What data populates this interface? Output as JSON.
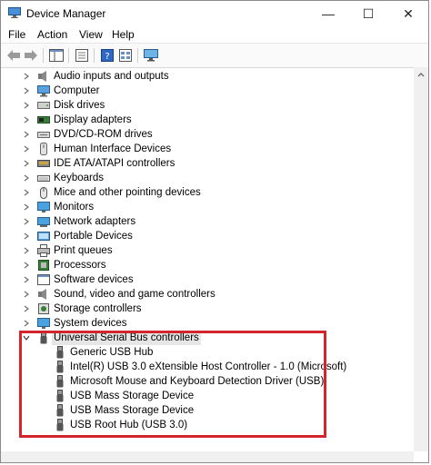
{
  "window": {
    "title": "Device Manager",
    "minimize_glyph": "—",
    "maximize_glyph": "☐",
    "close_glyph": "✕"
  },
  "menu": [
    "File",
    "Action",
    "View",
    "Help"
  ],
  "toolbar": [
    "back-arrow-icon",
    "forward-arrow-icon",
    "show-hide-console-tree-icon",
    "properties-icon",
    "help-icon",
    "view-icon",
    "scan-hardware-icon"
  ],
  "tree": {
    "categories": [
      {
        "label": "Audio inputs and outputs",
        "icon": "speaker-icon"
      },
      {
        "label": "Computer",
        "icon": "computer-icon"
      },
      {
        "label": "Disk drives",
        "icon": "disk-drive-icon"
      },
      {
        "label": "Display adapters",
        "icon": "display-adapter-icon"
      },
      {
        "label": "DVD/CD-ROM drives",
        "icon": "dvd-drive-icon"
      },
      {
        "label": "Human Interface Devices",
        "icon": "hid-icon"
      },
      {
        "label": "IDE ATA/ATAPI controllers",
        "icon": "ide-controller-icon"
      },
      {
        "label": "Keyboards",
        "icon": "keyboard-icon"
      },
      {
        "label": "Mice and other pointing devices",
        "icon": "mouse-icon"
      },
      {
        "label": "Monitors",
        "icon": "monitor-icon"
      },
      {
        "label": "Network adapters",
        "icon": "network-adapter-icon"
      },
      {
        "label": "Portable Devices",
        "icon": "portable-device-icon"
      },
      {
        "label": "Print queues",
        "icon": "printer-icon"
      },
      {
        "label": "Processors",
        "icon": "processor-icon"
      },
      {
        "label": "Software devices",
        "icon": "software-device-icon"
      },
      {
        "label": "Sound, video and game controllers",
        "icon": "sound-controller-icon"
      },
      {
        "label": "Storage controllers",
        "icon": "storage-controller-icon"
      },
      {
        "label": "System devices",
        "icon": "system-device-icon"
      }
    ],
    "usb": {
      "label": "Universal Serial Bus controllers",
      "icon": "usb-icon",
      "children": [
        "Generic USB Hub",
        "Intel(R) USB 3.0 eXtensible Host Controller - 1.0 (Microsoft)",
        "Microsoft Mouse and Keyboard Detection Driver (USB)",
        "USB Mass Storage Device",
        "USB Mass Storage Device",
        "USB Root Hub (USB 3.0)"
      ]
    }
  },
  "colors": {
    "highlight_box": "#d4242c",
    "selected_row": "#e6e6e6"
  }
}
